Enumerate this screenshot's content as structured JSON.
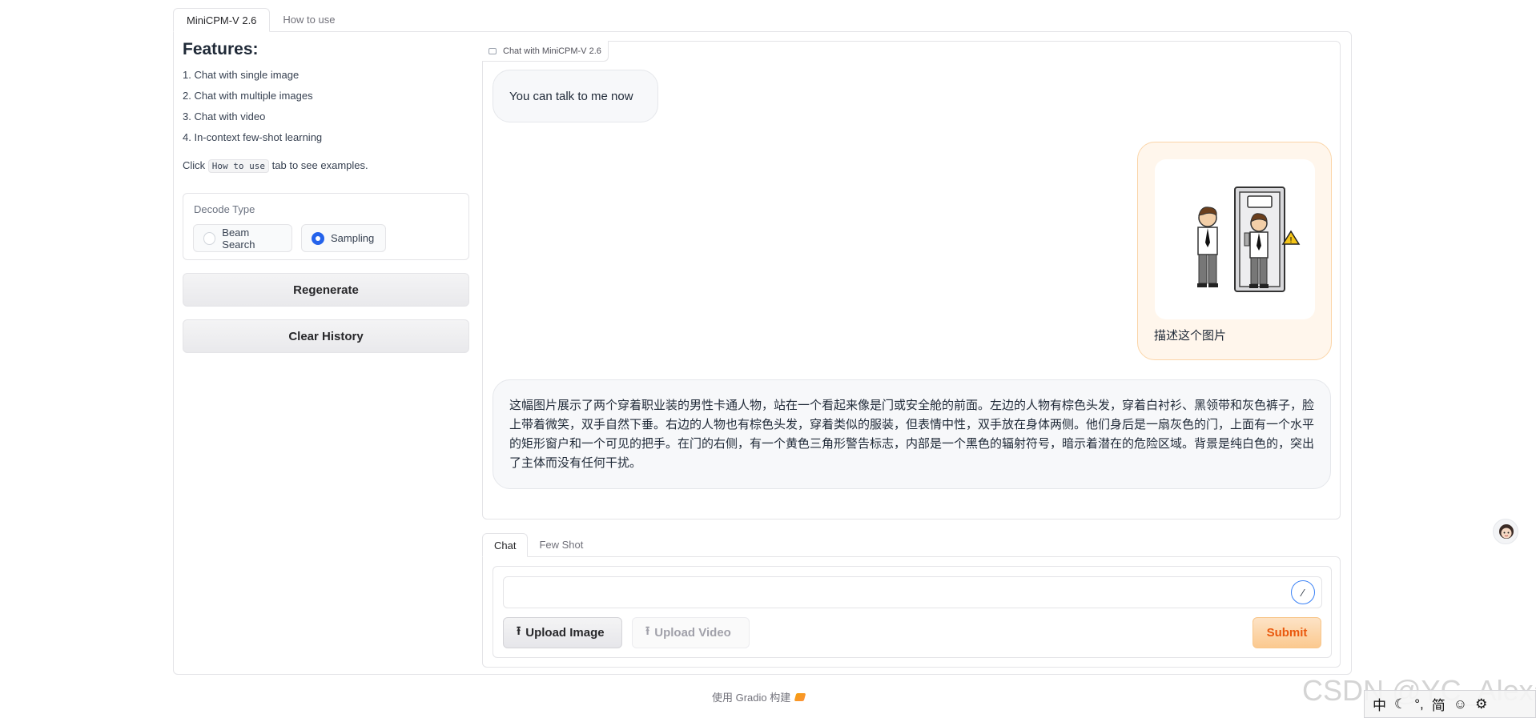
{
  "top_tabs": [
    {
      "label": "MiniCPM-V 2.6",
      "active": true
    },
    {
      "label": "How to use",
      "active": false
    }
  ],
  "features": {
    "title": "Features:",
    "items": [
      "1. Chat with single image",
      "2. Chat with multiple images",
      "3. Chat with video",
      "4. In-context few-shot learning"
    ],
    "click_prefix": "Click",
    "click_code": "How to use",
    "click_suffix": "tab to see examples."
  },
  "decode": {
    "label": "Decode Type",
    "options": [
      {
        "label": "Beam Search",
        "checked": false
      },
      {
        "label": "Sampling",
        "checked": true
      }
    ]
  },
  "buttons": {
    "regenerate": "Regenerate",
    "clear_history": "Clear History"
  },
  "chatbot": {
    "label": "Chat with MiniCPM-V 2.6",
    "messages": [
      {
        "role": "bot",
        "text": "You can talk to me now"
      },
      {
        "role": "user",
        "text": "描述这个图片",
        "image": "cartoon-men-door-warning"
      },
      {
        "role": "bot",
        "text": "这幅图片展示了两个穿着职业装的男性卡通人物，站在一个看起来像是门或安全舱的前面。左边的人物有棕色头发，穿着白衬衫、黑领带和灰色裤子，脸上带着微笑，双手自然下垂。右边的人物也有棕色头发，穿着类似的服装，但表情中性，双手放在身体两侧。他们身后是一扇灰色的门，上面有一个水平的矩形窗户和一个可见的把手。在门的右侧，有一个黄色三角形警告标志，内部是一个黑色的辐射符号，暗示着潜在的危险区域。背景是纯白色的，突出了主体而没有任何干扰。"
      }
    ]
  },
  "lower_tabs": [
    {
      "label": "Chat",
      "active": true
    },
    {
      "label": "Few Shot",
      "active": false
    }
  ],
  "input": {
    "value": "",
    "placeholder": ""
  },
  "actions": {
    "upload_image": "Upload Image",
    "upload_video": "Upload Video",
    "submit": "Submit"
  },
  "footer": {
    "text": "使用 Gradio 构建"
  },
  "overlay": {
    "watermark": "CSDN @YC_Alexa",
    "ime": [
      "中",
      "简"
    ]
  },
  "colors": {
    "accent": "#2563eb",
    "submit_text": "#ea580c",
    "user_bubble": "#fff6ec"
  }
}
